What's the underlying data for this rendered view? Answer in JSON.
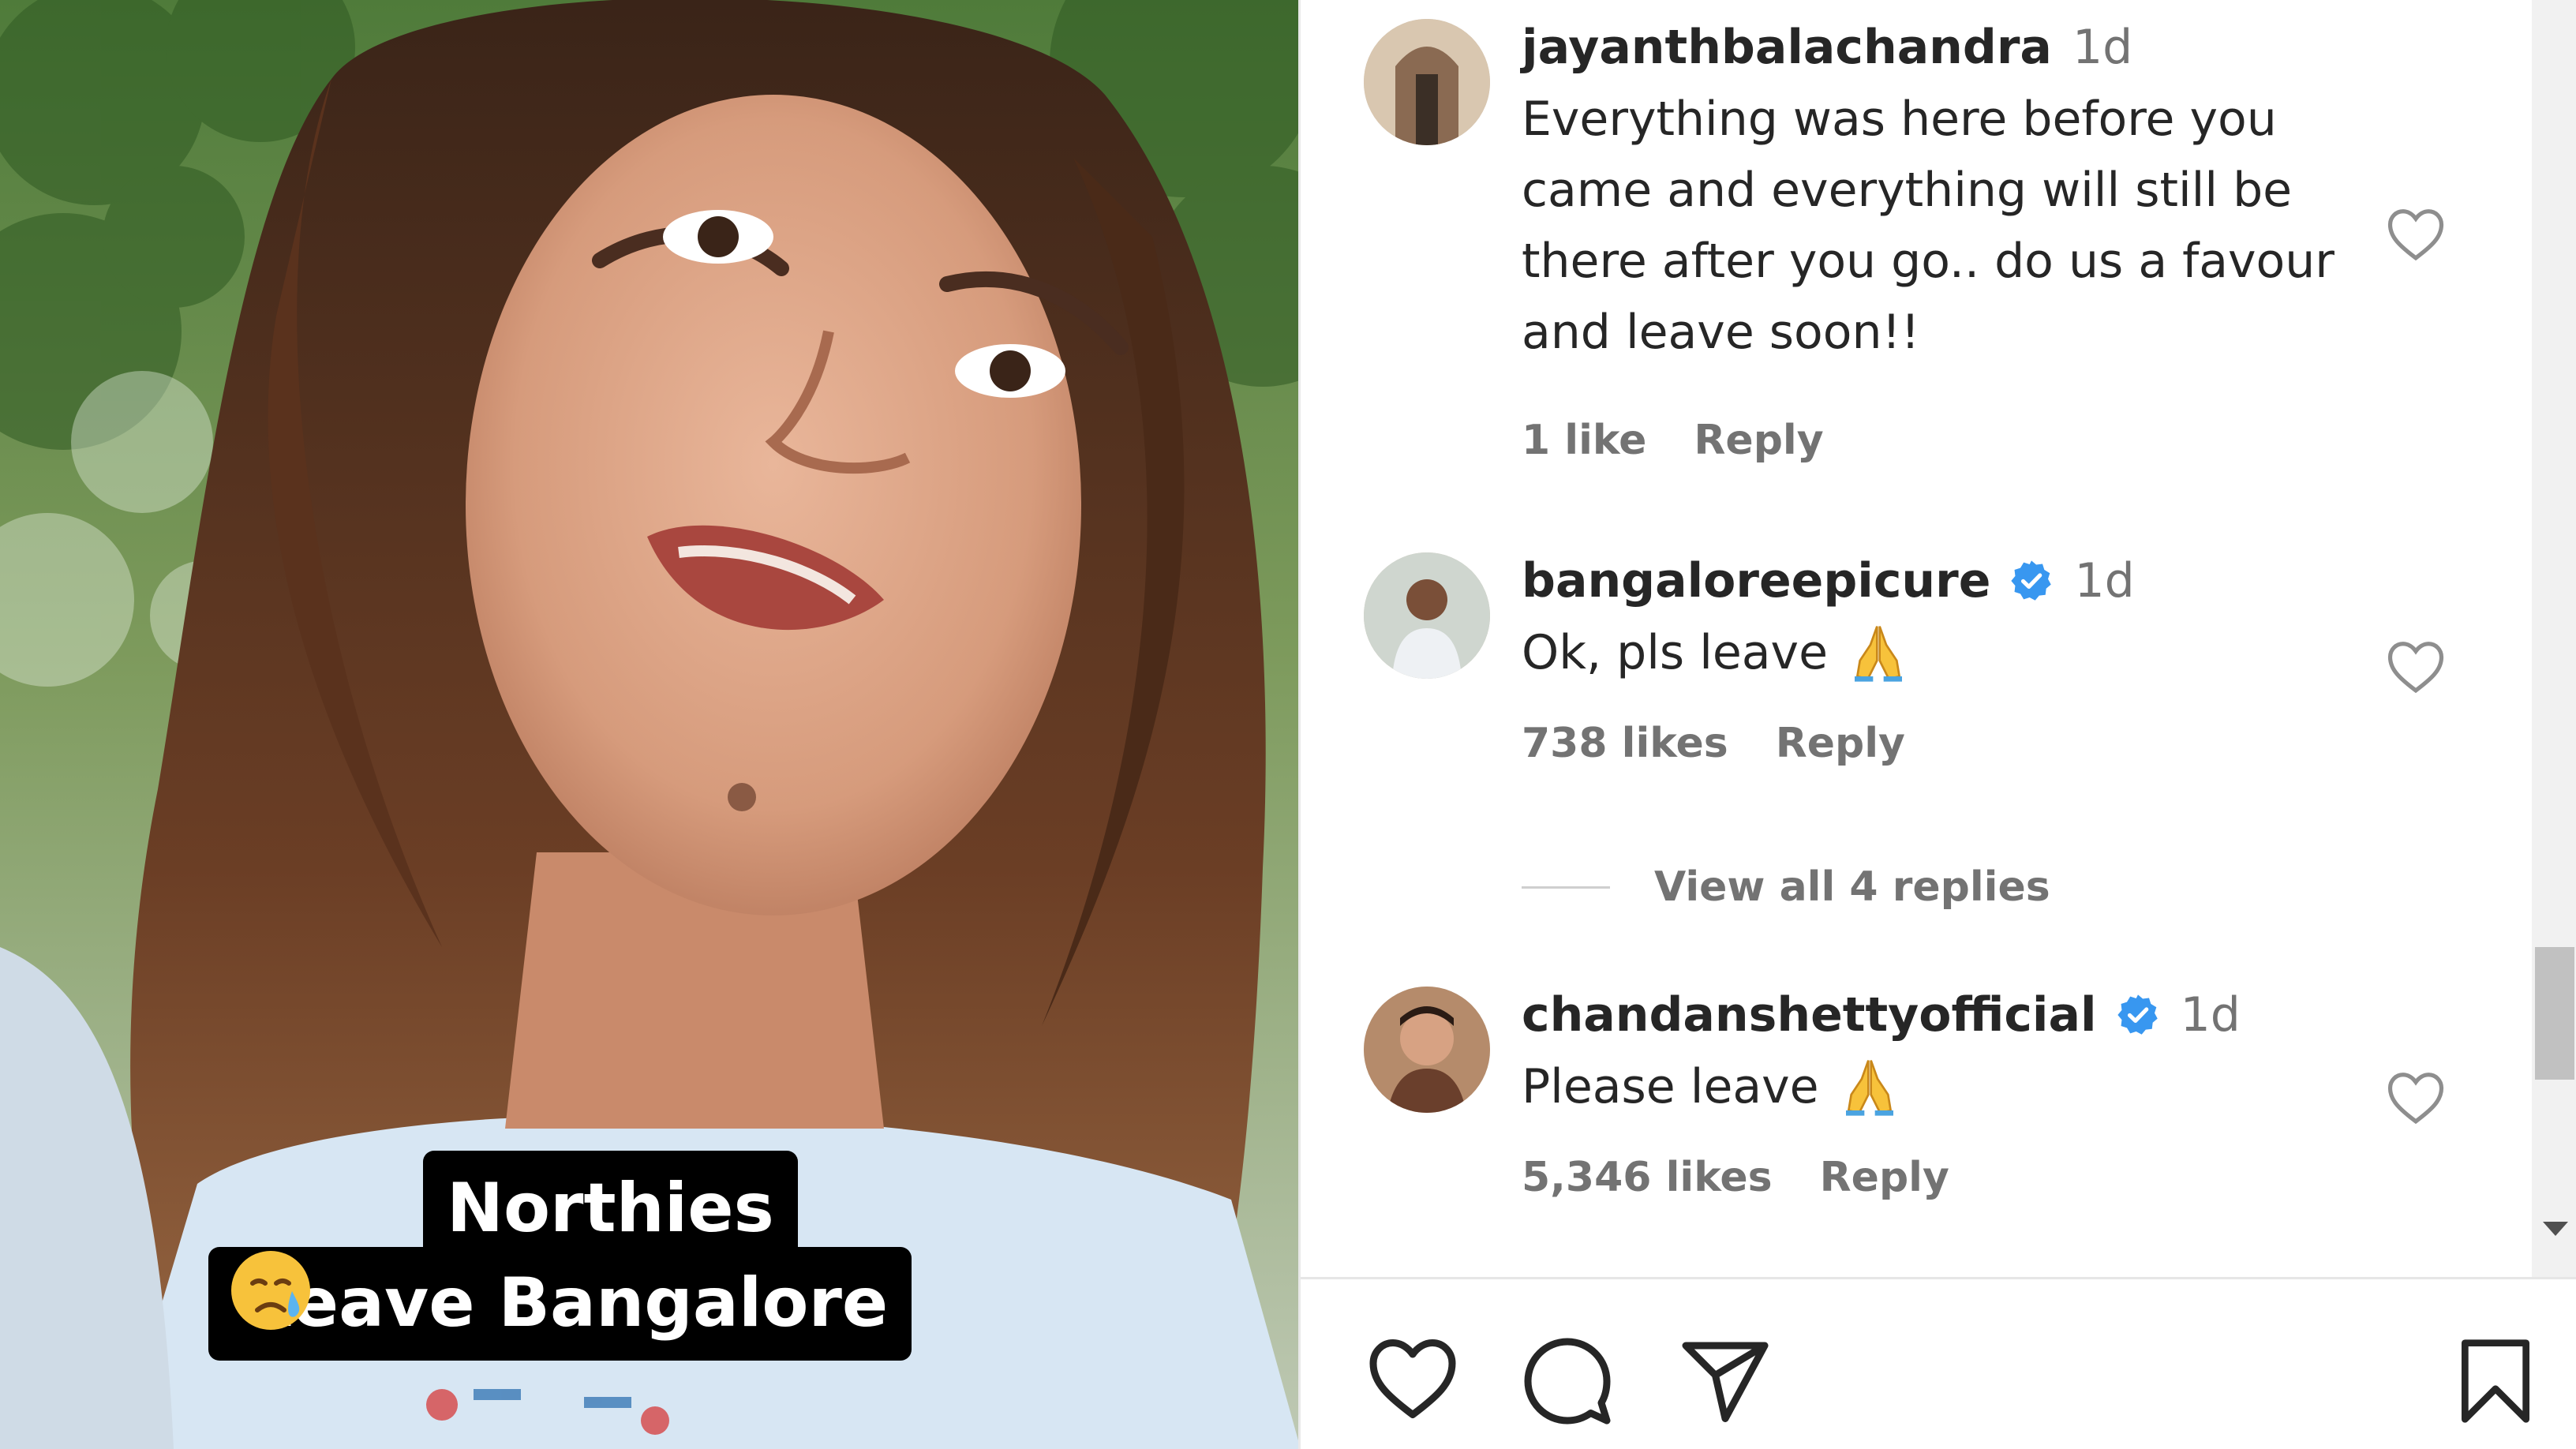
{
  "video": {
    "caption_line1": "Northies",
    "caption_line2": "Leave Bangalore",
    "caption_emoji": "crying-face-emoji"
  },
  "comments": [
    {
      "username": "jayanthbalachandra",
      "time": "1d",
      "verified": false,
      "text_lines": [
        "Everything was here before you",
        "came and everything will still be",
        "there after you go.. do us a favour",
        "and leave soon!!"
      ],
      "likes": "1 like",
      "reply": "Reply"
    },
    {
      "username": "bangaloreepicure",
      "time": "1d",
      "verified": true,
      "text": "Ok, pls leave",
      "likes": "738 likes",
      "reply": "Reply",
      "view_replies": "View all 4 replies"
    },
    {
      "username": "chandanshettyofficial",
      "time": "1d",
      "verified": true,
      "text": "Please leave",
      "likes": "5,346 likes",
      "reply": "Reply"
    }
  ],
  "actions": {
    "icons": [
      "like-icon",
      "comment-icon",
      "share-icon",
      "save-icon"
    ]
  },
  "colors": {
    "text": "#262626",
    "muted": "#737373",
    "verified": "#3897f0"
  }
}
